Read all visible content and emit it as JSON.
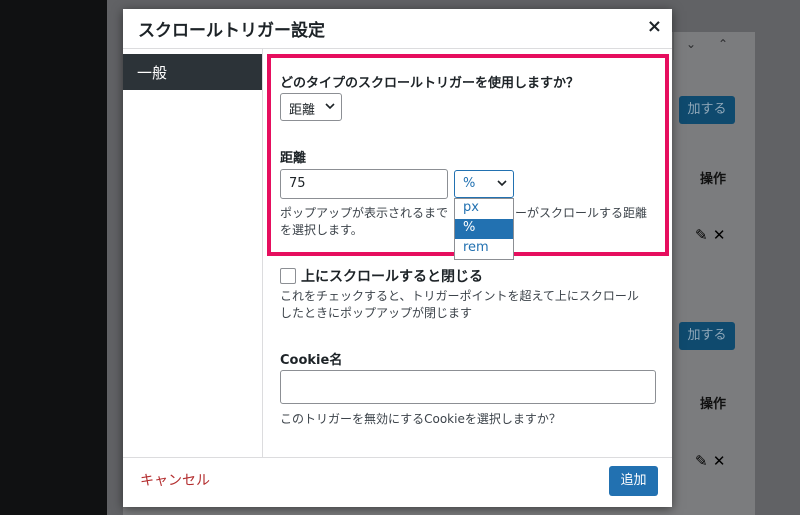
{
  "background": {
    "add_button_label": "加する",
    "actions_label": "操作",
    "edit_icon": "pencil-icon",
    "delete_icon": "x-icon",
    "top_text": "..."
  },
  "modal": {
    "title": "スクロールトリガー設定",
    "close_icon": "close-icon",
    "close_glyph": "×"
  },
  "sidebar": {
    "tabs": [
      {
        "label": "一般"
      }
    ]
  },
  "form": {
    "trigger_type": {
      "question": "どのタイプのスクロールトリガーを使用しますか？",
      "selected": "距離"
    },
    "distance": {
      "label": "距離",
      "value": "75",
      "unit_selected": "%",
      "unit_options": [
        "px",
        "%",
        "rem"
      ],
      "help_line1": "ポップアップが表示されるまで",
      "help_line1_end": "ーがスクロールする距離",
      "help_line2": "を選択します。"
    },
    "close_on_scroll_up": {
      "label": "上にスクロールすると閉じる",
      "checked": false,
      "help_line1": "これをチェックすると、トリガーポイントを超えて上にスクロール",
      "help_line2": "したときにポップアップが閉じます"
    },
    "cookie": {
      "label": "Cookie名",
      "value": "",
      "help": "このトリガーを無効にするCookieを選択しますか？"
    }
  },
  "footer": {
    "cancel_label": "キャンセル",
    "add_label": "追加"
  },
  "colors": {
    "highlight": "#e60e5e",
    "primary": "#2271b1",
    "cancel": "#b32d2e",
    "sidebar_active": "#2c3338"
  }
}
